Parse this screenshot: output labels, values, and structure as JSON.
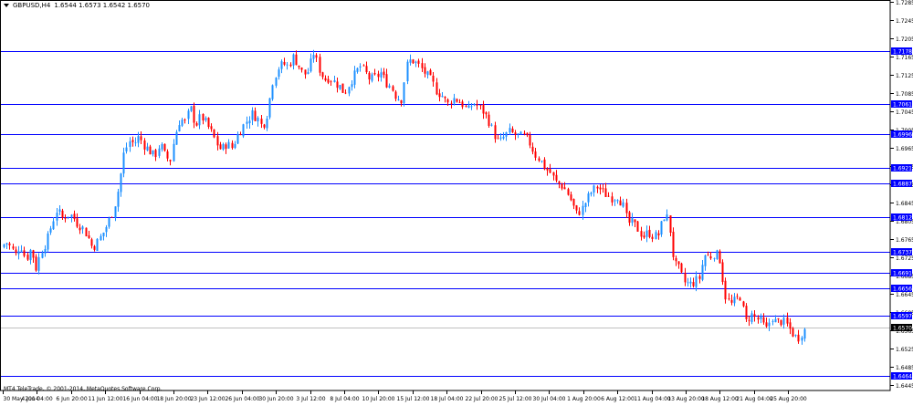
{
  "header": {
    "symbol": "GBPUSD,H4",
    "quotes": "1.6544 1.6573 1.6542 1.6570"
  },
  "footer": {
    "copyright": "MT4 TeleTrade, © 2001-2014, MetaQuotes Software Corp."
  },
  "colors": {
    "background": "#ffffff",
    "frame": "#000000",
    "bull_candle": "#1e90ff",
    "bear_candle": "#ff0000",
    "level_line": "#0000ff",
    "level_label_bg": "#0000ff",
    "level_label_text": "#ffffff",
    "price_line": "#c0c0c0",
    "price_label_bg": "#000000"
  },
  "chart_data": {
    "type": "candlestick",
    "title": "GBPUSD,H4",
    "ylim": [
      1.6432,
      1.729
    ],
    "y_ticks": [
      "1.7285",
      "1.7245",
      "1.7205",
      "1.7165",
      "1.7125",
      "1.7085",
      "1.7045",
      "1.7005",
      "1.6965",
      "1.6925",
      "1.6885",
      "1.6845",
      "1.6805",
      "1.6765",
      "1.6725",
      "1.6685",
      "1.6645",
      "1.6605",
      "1.6565",
      "1.6525",
      "1.6485",
      "1.6445"
    ],
    "x_ticks": [
      "30 May 2014",
      "4 Jun 04:00",
      "6 Jun 20:00",
      "11 Jun 12:00",
      "16 Jun 04:00",
      "18 Jun 20:00",
      "23 Jun 12:00",
      "26 Jun 04:00",
      "30 Jun 20:00",
      "3 Jul 12:00",
      "8 Jul 04:00",
      "10 Jul 20:00",
      "15 Jul 12:00",
      "18 Jul 04:00",
      "22 Jul 20:00",
      "25 Jul 12:00",
      "30 Jul 04:00",
      "1 Aug 20:00",
      "6 Aug 12:00",
      "11 Aug 04:00",
      "13 Aug 20:00",
      "18 Aug 12:00",
      "21 Aug 04:00",
      "25 Aug 20:00"
    ],
    "current_price": "1.6570",
    "horizontal_levels": [
      "1.7178",
      "1.7061",
      "1.6996",
      "1.6921",
      "1.6887",
      "1.6812",
      "1.6737",
      "1.6691",
      "1.6656",
      "1.6597",
      "1.6464"
    ],
    "close_path": [
      [
        0,
        1.674
      ],
      [
        6,
        1.676
      ],
      [
        12,
        1.6745
      ],
      [
        17,
        1.673
      ],
      [
        22,
        1.6755
      ],
      [
        28,
        1.672
      ],
      [
        34,
        1.6745
      ],
      [
        39,
        1.67
      ],
      [
        45,
        1.674
      ],
      [
        51,
        1.676
      ],
      [
        56,
        1.6795
      ],
      [
        62,
        1.683
      ],
      [
        68,
        1.681
      ],
      [
        73,
        1.682
      ],
      [
        79,
        1.6815
      ],
      [
        84,
        1.68
      ],
      [
        90,
        1.679
      ],
      [
        96,
        1.677
      ],
      [
        101,
        1.6745
      ],
      [
        107,
        1.676
      ],
      [
        113,
        1.678
      ],
      [
        118,
        1.68
      ],
      [
        124,
        1.683
      ],
      [
        130,
        1.688
      ],
      [
        135,
        1.695
      ],
      [
        141,
        1.698
      ],
      [
        147,
        1.6975
      ],
      [
        152,
        1.699
      ],
      [
        158,
        1.697
      ],
      [
        163,
        1.696
      ],
      [
        169,
        1.6945
      ],
      [
        175,
        1.6975
      ],
      [
        180,
        1.695
      ],
      [
        186,
        1.6935
      ],
      [
        191,
        1.699
      ],
      [
        197,
        1.703
      ],
      [
        203,
        1.702
      ],
      [
        208,
        1.7055
      ],
      [
        214,
        1.7015
      ],
      [
        220,
        1.7035
      ],
      [
        225,
        1.702
      ],
      [
        231,
        1.7
      ],
      [
        237,
        1.6975
      ],
      [
        242,
        1.696
      ],
      [
        248,
        1.6975
      ],
      [
        254,
        1.6965
      ],
      [
        259,
        1.699
      ],
      [
        265,
        1.701
      ],
      [
        270,
        1.7025
      ],
      [
        276,
        1.704
      ],
      [
        282,
        1.703
      ],
      [
        287,
        1.701
      ],
      [
        293,
        1.7045
      ],
      [
        298,
        1.711
      ],
      [
        304,
        1.714
      ],
      [
        310,
        1.715
      ],
      [
        315,
        1.7145
      ],
      [
        321,
        1.7165
      ],
      [
        326,
        1.715
      ],
      [
        332,
        1.7125
      ],
      [
        338,
        1.7135
      ],
      [
        343,
        1.7175
      ],
      [
        349,
        1.714
      ],
      [
        355,
        1.7115
      ],
      [
        360,
        1.712
      ],
      [
        366,
        1.711
      ],
      [
        372,
        1.71
      ],
      [
        377,
        1.7085
      ],
      [
        383,
        1.711
      ],
      [
        388,
        1.7125
      ],
      [
        394,
        1.7145
      ],
      [
        400,
        1.713
      ],
      [
        405,
        1.7115
      ],
      [
        411,
        1.712
      ],
      [
        417,
        1.713
      ],
      [
        422,
        1.711
      ],
      [
        428,
        1.71
      ],
      [
        433,
        1.708
      ],
      [
        439,
        1.707
      ],
      [
        445,
        1.7145
      ],
      [
        450,
        1.716
      ],
      [
        456,
        1.715
      ],
      [
        461,
        1.714
      ],
      [
        467,
        1.7125
      ],
      [
        473,
        1.711
      ],
      [
        478,
        1.709
      ],
      [
        484,
        1.708
      ],
      [
        490,
        1.706
      ],
      [
        495,
        1.7075
      ],
      [
        501,
        1.707
      ],
      [
        507,
        1.706
      ],
      [
        512,
        1.7045
      ],
      [
        518,
        1.7065
      ],
      [
        524,
        1.7055
      ],
      [
        529,
        1.7045
      ],
      [
        535,
        1.7025
      ],
      [
        541,
        1.6995
      ],
      [
        546,
        1.6975
      ],
      [
        552,
        1.699
      ],
      [
        557,
        1.7
      ],
      [
        563,
        1.6995
      ],
      [
        569,
        1.699
      ],
      [
        574,
        1.699
      ],
      [
        580,
        1.6975
      ],
      [
        586,
        1.695
      ],
      [
        591,
        1.694
      ],
      [
        597,
        1.692
      ],
      [
        603,
        1.691
      ],
      [
        608,
        1.689
      ],
      [
        614,
        1.6885
      ],
      [
        620,
        1.687
      ],
      [
        625,
        1.685
      ],
      [
        631,
        1.682
      ],
      [
        637,
        1.683
      ],
      [
        642,
        1.685
      ],
      [
        648,
        1.687
      ],
      [
        654,
        1.688
      ],
      [
        659,
        1.687
      ],
      [
        665,
        1.686
      ],
      [
        671,
        1.6855
      ],
      [
        676,
        1.686
      ],
      [
        682,
        1.684
      ],
      [
        687,
        1.68
      ],
      [
        693,
        1.68
      ],
      [
        699,
        1.6785
      ],
      [
        704,
        1.677
      ],
      [
        710,
        1.678
      ],
      [
        716,
        1.677
      ],
      [
        721,
        1.6775
      ],
      [
        727,
        1.6815
      ],
      [
        732,
        1.681
      ],
      [
        738,
        1.671
      ],
      [
        743,
        1.67
      ],
      [
        749,
        1.667
      ],
      [
        755,
        1.6665
      ],
      [
        760,
        1.667
      ],
      [
        766,
        1.668
      ],
      [
        771,
        1.673
      ],
      [
        777,
        1.6725
      ],
      [
        783,
        1.6735
      ],
      [
        788,
        1.672
      ],
      [
        794,
        1.664
      ],
      [
        800,
        1.662
      ],
      [
        805,
        1.663
      ],
      [
        811,
        1.664
      ],
      [
        816,
        1.658
      ],
      [
        822,
        1.66
      ],
      [
        828,
        1.659
      ],
      [
        833,
        1.6585
      ],
      [
        839,
        1.6565
      ],
      [
        845,
        1.6595
      ],
      [
        850,
        1.658
      ],
      [
        856,
        1.6585
      ],
      [
        862,
        1.6575
      ],
      [
        867,
        1.656
      ],
      [
        873,
        1.6545
      ],
      [
        878,
        1.656
      ],
      [
        884,
        1.657
      ]
    ]
  }
}
